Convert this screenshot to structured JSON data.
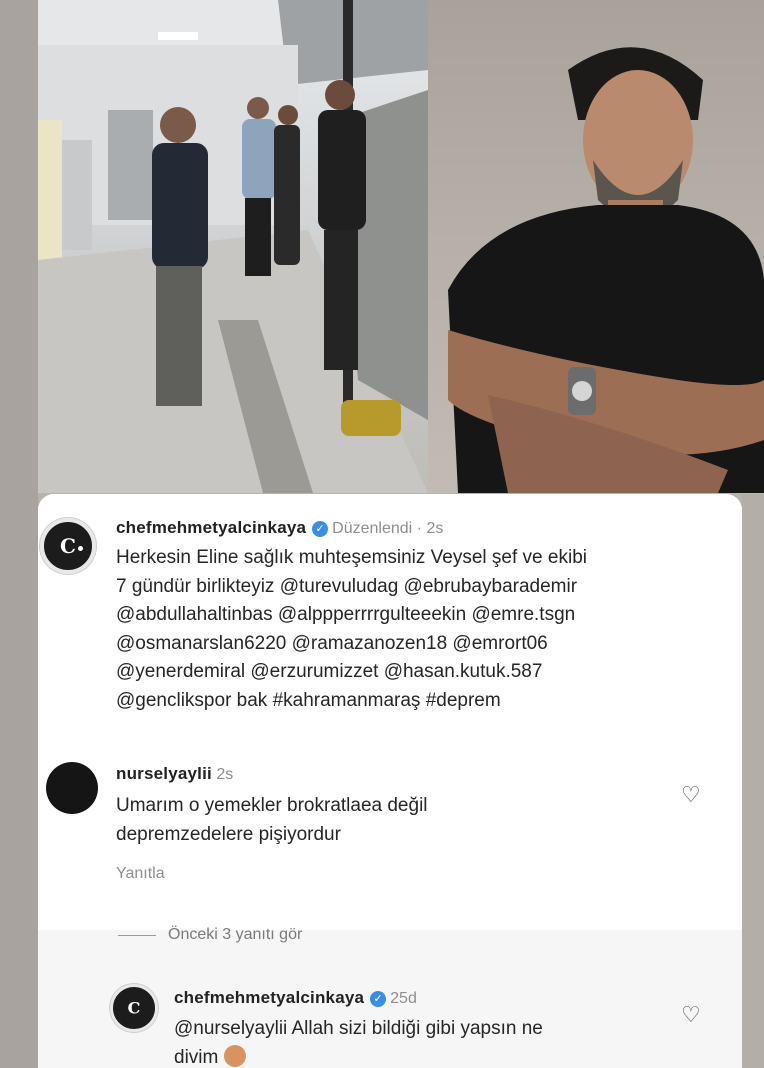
{
  "post": {
    "username": "chefmehmetyalcinkaya",
    "edited": "Düzenlendi",
    "time": "· 2s",
    "avatar_mark": "C",
    "lines": [
      "Herkesin Eline sağlık muhteşemsiniz Veysel şef ve ekibi",
      "7 gündür birlikteyiz @turevuludag @ebrubaybarademir",
      "@abdullahaltinbas @alppperrrrgulteeekin @emre.tsgn",
      "@osmanarslan6220 @ramazanozen18 @emrort06",
      "@yenerdemiral @erzurumizzet  @hasan.kutuk.587",
      "@genclikspor bak #kahramanmaraş #deprem"
    ]
  },
  "comment1": {
    "username": "nurselyaylii",
    "time": "2s",
    "lines": [
      "Umarım o yemekler brokratlaea değil",
      "depremzedelere pişiyordur"
    ],
    "reply_label": "Yanıtla"
  },
  "thread": {
    "view_previous": "Önceki 3 yanıtı gör"
  },
  "comment2": {
    "username": "chefmehmetyalcinkaya",
    "time": "25d",
    "avatar_mark": "C",
    "lines": [
      "@nurselyaylii Allah sizi bildiği gibi yapsın ne",
      "divim"
    ]
  },
  "icons": {
    "verified": "verified-badge-icon",
    "like": "heart-outline-icon"
  },
  "colors": {
    "verified_blue": "#3a8de0",
    "card_bg": "#ffffff"
  }
}
